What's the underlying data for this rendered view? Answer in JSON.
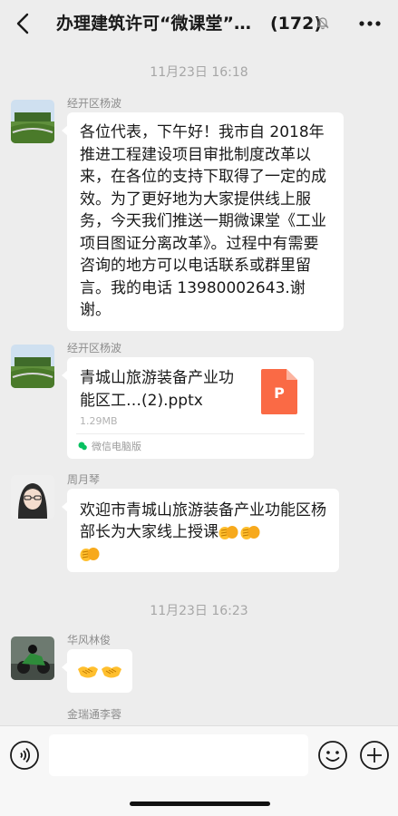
{
  "header": {
    "title": "办理建筑许可“微课堂”…",
    "count": "(172)",
    "back_icon": "chevron-left-icon",
    "mute_icon": "bell-muted-icon",
    "more_icon": "more-dots-icon"
  },
  "messages": [
    {
      "type": "time",
      "text": "11月23日 16:18"
    },
    {
      "type": "text",
      "sender": "经开区杨波",
      "text": "各位代表，下午好！我市自 2018年推进工程建设项目审批制度改革以来，在各位的支持下取得了一定的成效。为了更好地为大家提供线上服务，今天我们推送一期微课堂《工业项目图证分离改革》。过程中有需要咨询的地方可以电话联系或群里留言。我的电话 13980002643.谢谢。"
    },
    {
      "type": "file",
      "sender": "经开区杨波",
      "file_name": "青城山旅游装备产业功能区工…(2).pptx",
      "file_size": "1.29MB",
      "source": "微信电脑版",
      "file_badge": "P"
    },
    {
      "type": "text",
      "sender": "周月琴",
      "text": "欢迎市青城山旅游装备产业功能区杨部长为大家线上授课",
      "emoji_count": 3
    },
    {
      "type": "time",
      "text": "11月23日 16:23"
    },
    {
      "type": "emoji",
      "sender": "华风林俊",
      "emoji_count": 2
    },
    {
      "type": "partial",
      "sender": "金瑞通李蓉"
    }
  ],
  "input_bar": {
    "voice_icon": "voice-icon",
    "emoji_icon": "smiley-icon",
    "plus_icon": "plus-icon",
    "placeholder": ""
  },
  "colors": {
    "background": "#ededed",
    "bubble": "#ffffff",
    "ppt_orange": "#fa6a45",
    "source_green": "#07c160"
  }
}
